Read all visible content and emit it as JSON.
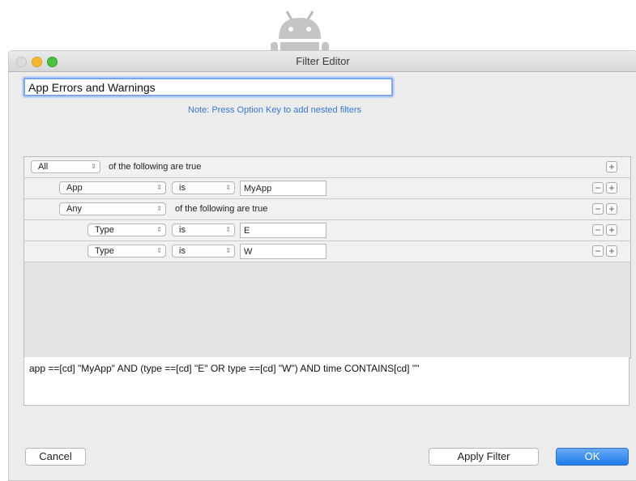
{
  "window": {
    "title": "Filter Editor"
  },
  "filter_name": {
    "value": "App Errors and Warnings"
  },
  "note": "Note: Press Option Key to add nested filters",
  "rows": [
    {
      "type": "compound",
      "quantifier": "All",
      "text": "of the following are true"
    },
    {
      "type": "criterion",
      "field": "App",
      "op": "is",
      "value": "MyApp"
    },
    {
      "type": "compound",
      "quantifier": "Any",
      "text": "of the following are true"
    },
    {
      "type": "criterion",
      "field": "Type",
      "op": "is",
      "value": "E"
    },
    {
      "type": "criterion",
      "field": "Type",
      "op": "is",
      "value": "W"
    }
  ],
  "predicate": "app ==[cd] \"MyApp\" AND (type ==[cd] \"E\" OR type ==[cd] \"W\") AND time CONTAINS[cd] \"\"",
  "buttons": {
    "cancel": "Cancel",
    "apply": "Apply Filter",
    "ok": "OK"
  },
  "icons": {
    "add": "+",
    "remove": "−",
    "popup_arrow": "⌃⌄"
  }
}
